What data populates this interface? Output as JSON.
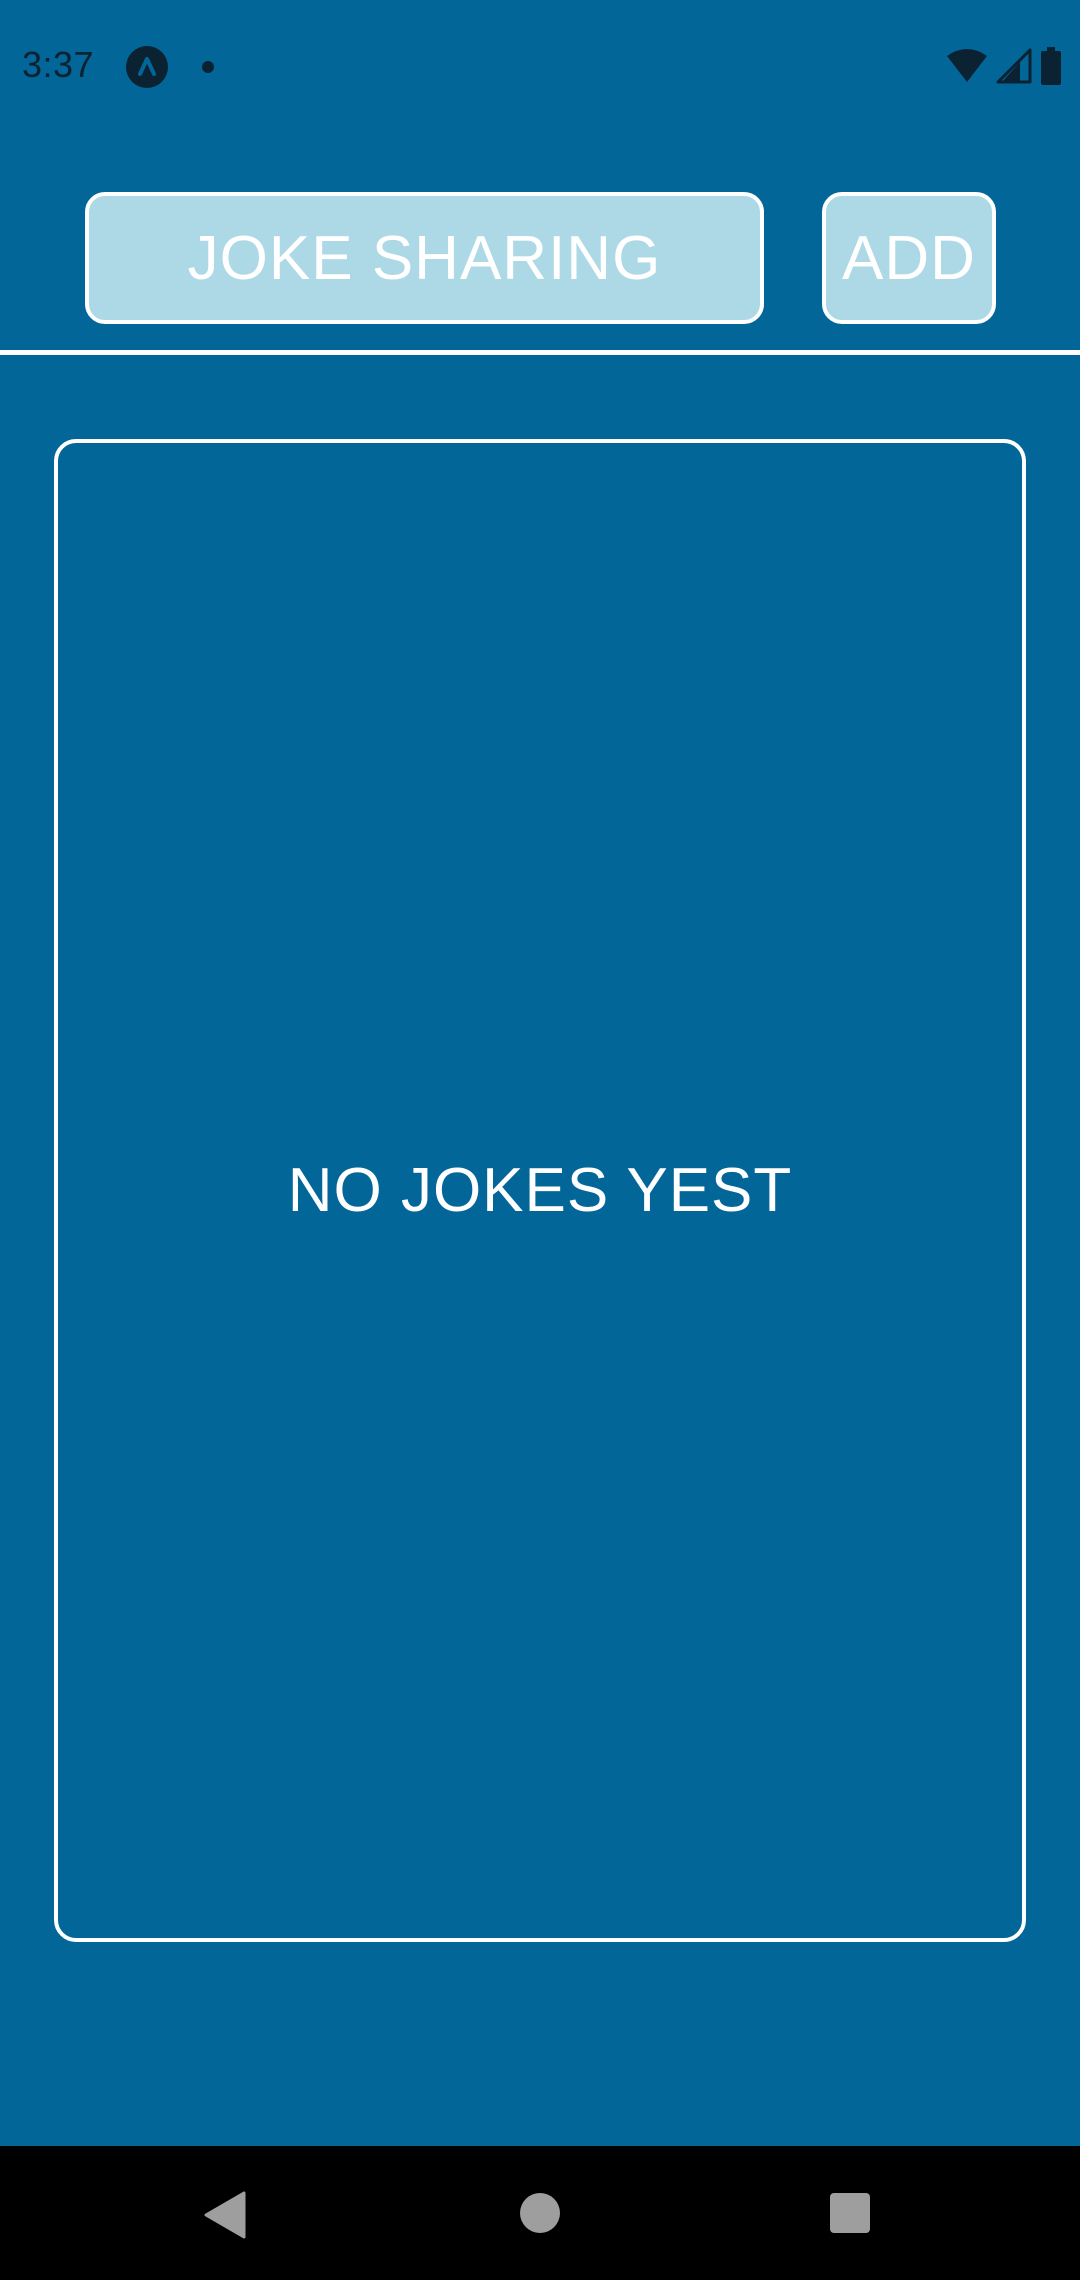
{
  "status_bar": {
    "time": "3:37",
    "icons": [
      "expo-app-icon",
      "notification-dot-icon",
      "wifi-icon",
      "cell-signal-icon",
      "battery-icon"
    ]
  },
  "header": {
    "title": "JOKE SHARING",
    "add_label": "ADD"
  },
  "jokes": {
    "empty_message": "NO JOKES YEST"
  },
  "nav_bar": {
    "icons": [
      "back-icon",
      "home-icon",
      "recents-icon"
    ]
  },
  "colors": {
    "background": "#036699",
    "button_fill": "#add8e6",
    "border": "#ffffff",
    "status_icons": "#0b2233",
    "nav_bar": "#000000",
    "nav_icons": "#9e9e9e"
  }
}
